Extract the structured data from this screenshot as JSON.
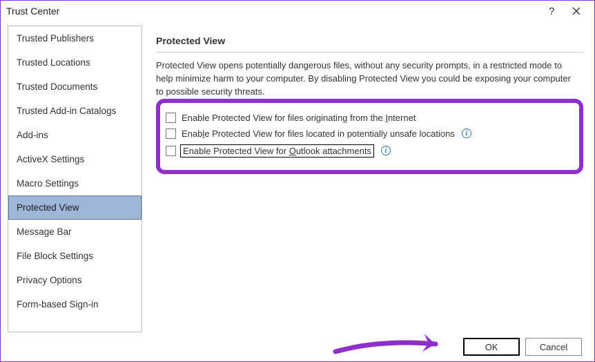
{
  "title": "Trust Center",
  "titlebar": {
    "help": "?",
    "close": "×"
  },
  "sidebar": {
    "items": [
      "Trusted Publishers",
      "Trusted Locations",
      "Trusted Documents",
      "Trusted Add-in Catalogs",
      "Add-ins",
      "ActiveX Settings",
      "Macro Settings",
      "Protected View",
      "Message Bar",
      "File Block Settings",
      "Privacy Options",
      "Form-based Sign-in"
    ],
    "selectedIndex": 7
  },
  "main": {
    "heading": "Protected View",
    "description": "Protected View opens potentially dangerous files, without any security prompts, in a restricted mode to help minimize harm to your computer. By disabling Protected View you could be exposing your computer to possible security threats.",
    "options": [
      {
        "label": "Enable Protected View for files originating from the Internet",
        "checked": false,
        "hasInfo": false,
        "accessKey": "I",
        "focused": false
      },
      {
        "label": "Enable Protected View for files located in potentially unsafe locations",
        "checked": false,
        "hasInfo": true,
        "accessKey": "l",
        "focused": false
      },
      {
        "label": "Enable Protected View for Outlook attachments",
        "checked": false,
        "hasInfo": true,
        "accessKey": "O",
        "focused": true
      }
    ]
  },
  "footer": {
    "ok": "OK",
    "cancel": "Cancel"
  },
  "info_glyph": "i"
}
